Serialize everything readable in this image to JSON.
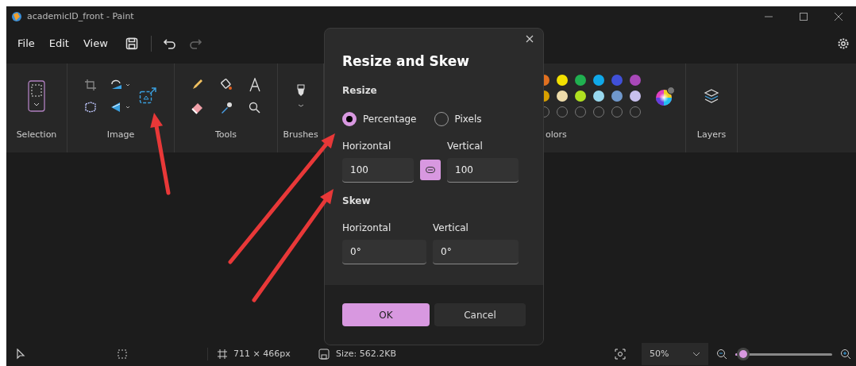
{
  "window": {
    "title": "academicID_front - Paint"
  },
  "menu": [
    {
      "label": "File"
    },
    {
      "label": "Edit"
    },
    {
      "label": "View"
    }
  ],
  "ribbon": {
    "groups": [
      {
        "label": "Selection"
      },
      {
        "label": "Image"
      },
      {
        "label": "Tools"
      },
      {
        "label": "Brushes"
      },
      {
        "label": "olors"
      },
      {
        "label": "Layers"
      }
    ],
    "palette": [
      {
        "color": "#e07020"
      },
      {
        "color": "#f2e000"
      },
      {
        "color": "#20b050"
      },
      {
        "color": "#10a8e8"
      },
      {
        "color": "#4050d8"
      },
      {
        "color": "#a848b8"
      },
      {
        "color": "#d8a000"
      },
      {
        "color": "#eedcaa"
      },
      {
        "color": "#b0e020"
      },
      {
        "color": "#98d8ee"
      },
      {
        "color": "#7098cc"
      },
      {
        "color": "#c8c0ee"
      },
      {
        "kind": "empty"
      },
      {
        "kind": "empty"
      },
      {
        "kind": "empty"
      },
      {
        "kind": "empty"
      },
      {
        "kind": "empty"
      },
      {
        "kind": "empty"
      }
    ]
  },
  "status_bar": {
    "dimensions": "711 × 466px",
    "size": "Size: 562.2KB",
    "zoom": "50%",
    "zoom_slider": {
      "level": 0.08
    }
  },
  "dialog": {
    "title": "Resize and Skew",
    "resize_heading": "Resize",
    "units": [
      {
        "label": "Percentage",
        "selected": true
      },
      {
        "label": "Pixels",
        "selected": false
      }
    ],
    "resize_fields": [
      {
        "label": "Horizontal",
        "value": "100"
      },
      {
        "label": "Vertical",
        "value": "100"
      }
    ],
    "aspect_locked": true,
    "skew_heading": "Skew",
    "skew_fields": [
      {
        "label": "Horizontal",
        "value": "0°"
      },
      {
        "label": "Vertical",
        "value": "0°"
      }
    ],
    "buttons": [
      {
        "label": "OK",
        "kind": "primary"
      },
      {
        "label": "Cancel",
        "kind": "secondary"
      }
    ]
  }
}
